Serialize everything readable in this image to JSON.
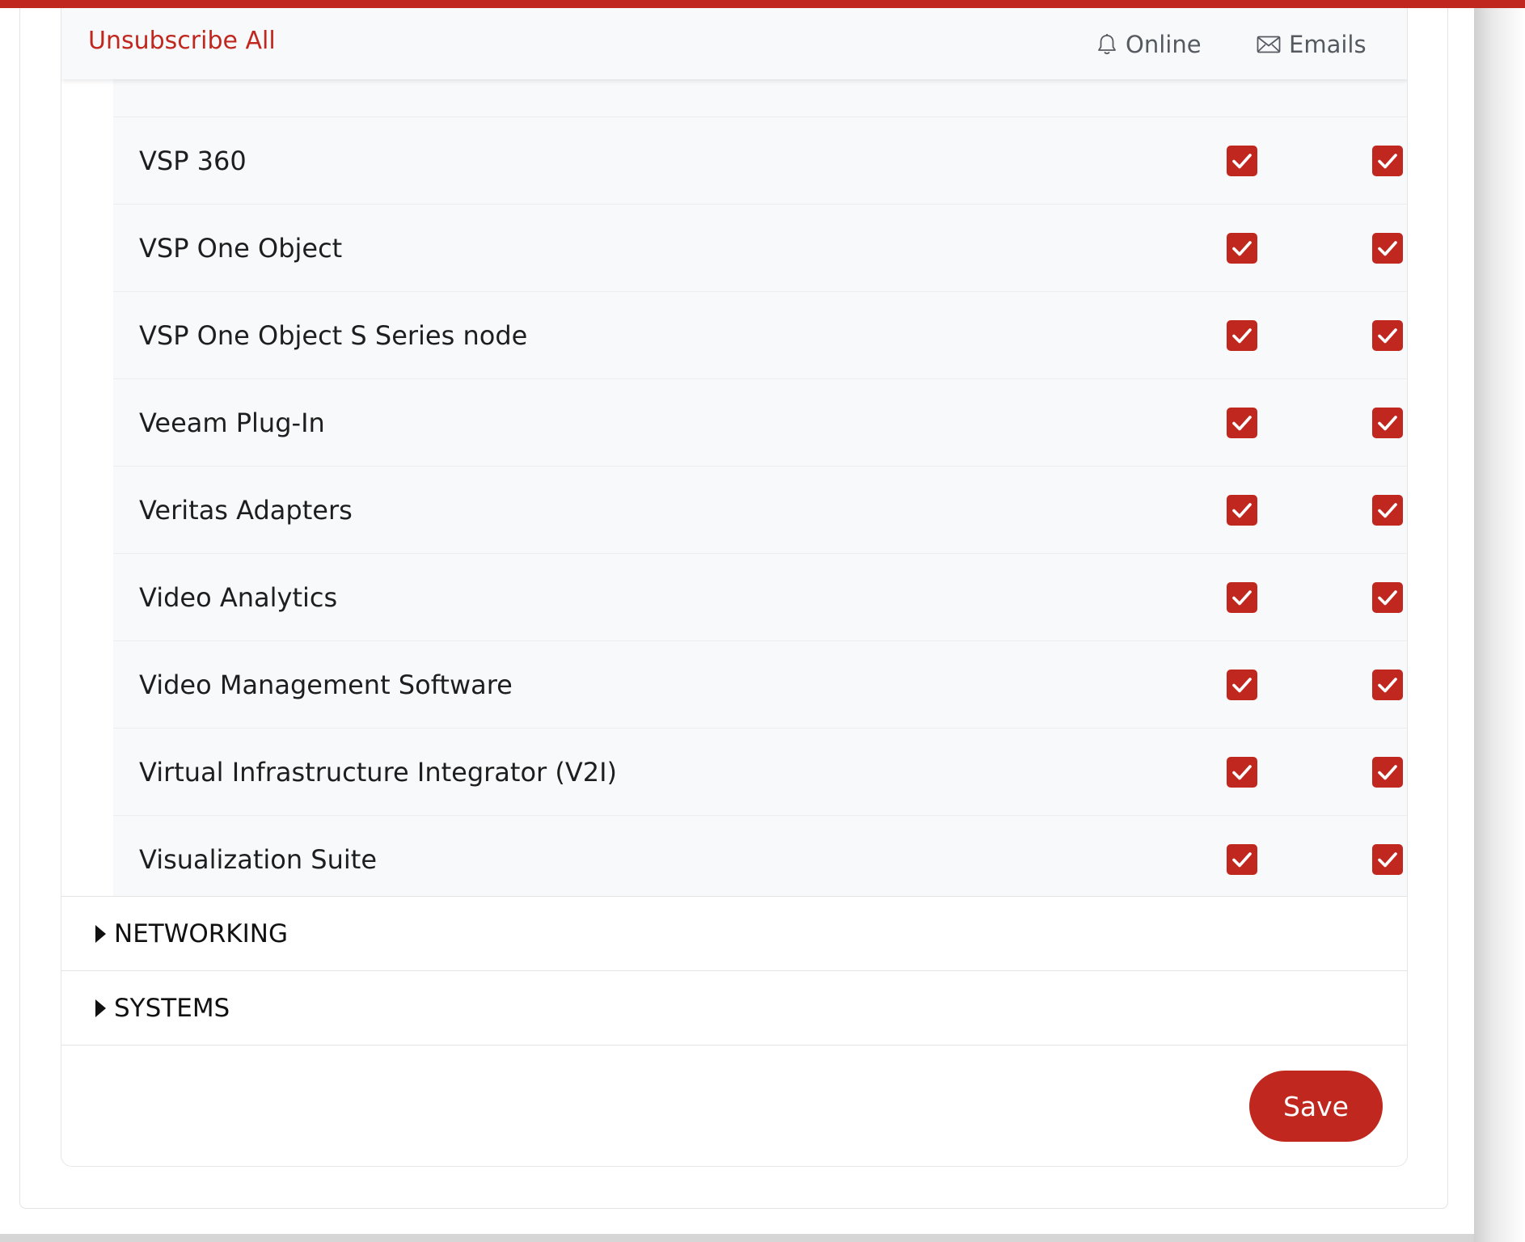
{
  "header": {
    "unsubscribe_label": "Unsubscribe All",
    "columns": {
      "online": {
        "label": "Online",
        "icon": "bell-icon"
      },
      "emails": {
        "label": "Emails",
        "icon": "envelope-icon"
      }
    }
  },
  "subscriptions": [
    {
      "label": "VSP 360",
      "online": true,
      "email": true
    },
    {
      "label": "VSP One Object",
      "online": true,
      "email": true
    },
    {
      "label": "VSP One Object S Series node",
      "online": true,
      "email": true
    },
    {
      "label": "Veeam Plug-In",
      "online": true,
      "email": true
    },
    {
      "label": "Veritas Adapters",
      "online": true,
      "email": true
    },
    {
      "label": "Video Analytics",
      "online": true,
      "email": true
    },
    {
      "label": "Video Management Software",
      "online": true,
      "email": true
    },
    {
      "label": "Virtual Infrastructure Integrator (V2I)",
      "online": true,
      "email": true
    },
    {
      "label": "Visualization Suite",
      "online": true,
      "email": true
    }
  ],
  "sections": [
    {
      "label": "NETWORKING",
      "expanded": false
    },
    {
      "label": "SYSTEMS",
      "expanded": false
    }
  ],
  "footer": {
    "save_label": "Save"
  },
  "colors": {
    "accent": "#c0281f",
    "row_bg": "#f8f9fa",
    "header_text": "#555a60"
  }
}
